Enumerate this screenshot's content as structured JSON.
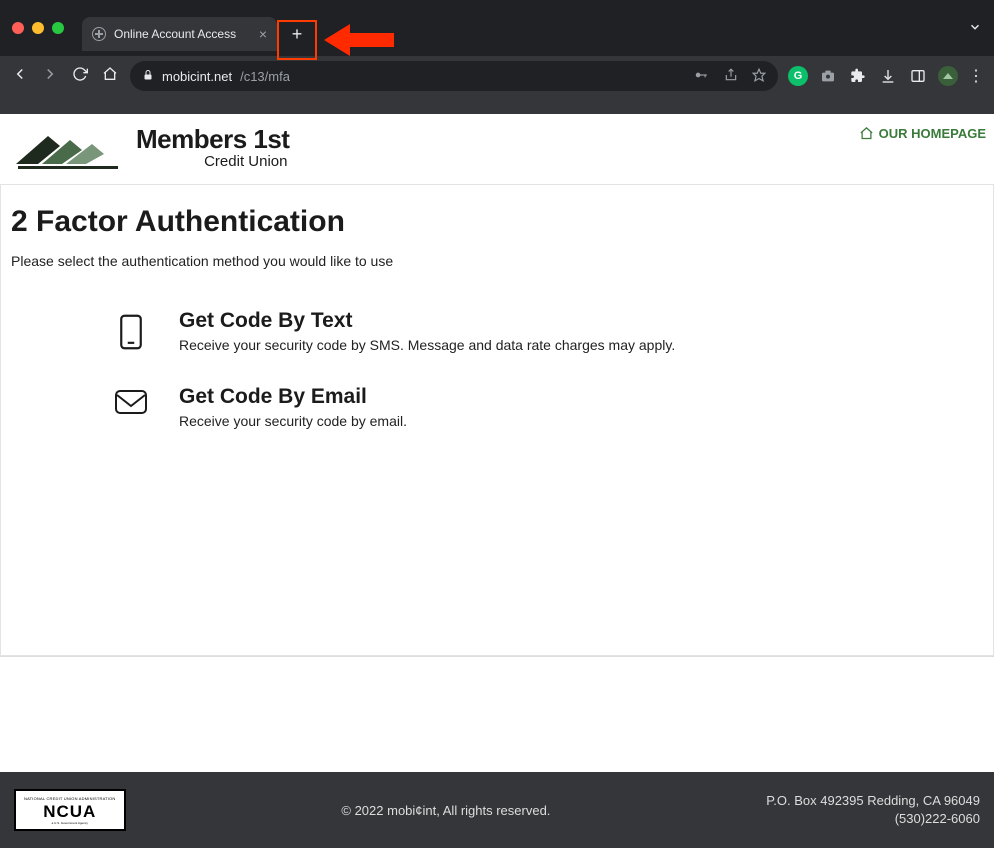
{
  "browser": {
    "tab_title": "Online Account Access",
    "url_host": "mobicint.net",
    "url_path": "/c13/mfa"
  },
  "header": {
    "brand_line1": "Members 1st",
    "brand_line2": "Credit Union",
    "homepage_label": "OUR HOMEPAGE"
  },
  "main": {
    "heading": "2 Factor Authentication",
    "subheading": "Please select the authentication method you would like to use",
    "options": [
      {
        "title": "Get Code By Text",
        "desc": "Receive your security code by SMS. Message and data rate charges may apply."
      },
      {
        "title": "Get Code By Email",
        "desc": "Receive your security code by email."
      }
    ]
  },
  "footer": {
    "ncua_label": "NCUA",
    "copyright": "© 2022 mobi¢int, All rights reserved.",
    "address": "P.O. Box 492395 Redding, CA 96049",
    "phone": "(530)222-6060"
  }
}
